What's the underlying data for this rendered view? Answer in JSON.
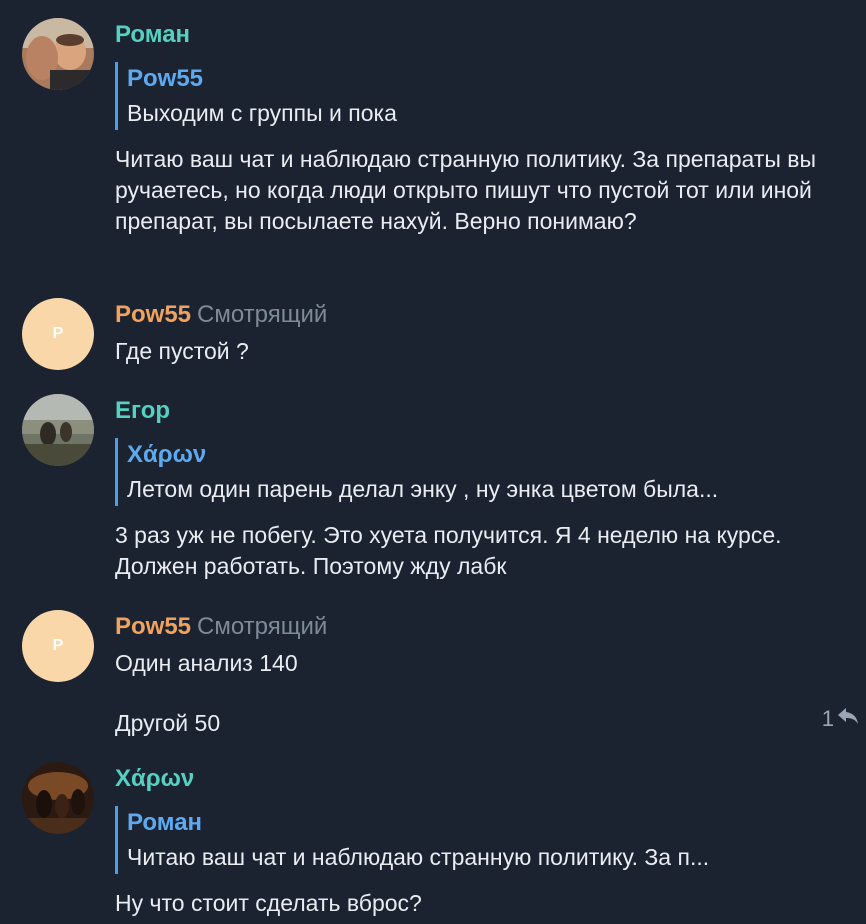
{
  "messages": [
    {
      "sender": "Роман",
      "sender_color": "#56d0c0",
      "avatar_icon": "photo-avatar",
      "reply": {
        "name": "Pow55",
        "text": "Выходим с группы и пока"
      },
      "text": "Читаю ваш чат и наблюдаю странную политику. За препараты вы ручаетесь, но когда люди открыто пишут что пустой тот или иной препарат, вы посылаете нахуй. Верно понимаю?"
    },
    {
      "sender": "Pow55",
      "role": "Смотрящий",
      "sender_color": "#f0a25e",
      "avatar_letter": "P",
      "avatar_color": "#fad7a9",
      "text": "Где пустой ?"
    },
    {
      "sender": "Егор",
      "sender_color": "#56d0c0",
      "avatar_icon": "photo-avatar",
      "reply": {
        "name": "Χάρων",
        "text": "Летом один парень делал энку , ну энка цветом была..."
      },
      "text": "3 раз уж не побегу. Это хуета получится. Я 4 неделю на курсе. Должен работать. Поэтому жду лабк"
    },
    {
      "sender": "Pow55",
      "role": "Смотрящий",
      "sender_color": "#f0a25e",
      "avatar_letter": "P",
      "avatar_color": "#fad7a9",
      "text": "Один анализ 140",
      "followup_text": "Другой 50",
      "reaction_count": "1",
      "reaction_icon": "reply-arrow-icon"
    },
    {
      "sender": "Χάρων",
      "sender_color": "#56d0c0",
      "avatar_icon": "photo-avatar",
      "reply": {
        "name": "Роман",
        "text": "Читаю ваш чат и наблюдаю странную политику. За п..."
      },
      "text": "Ну что стоит сделать вброс?"
    }
  ]
}
